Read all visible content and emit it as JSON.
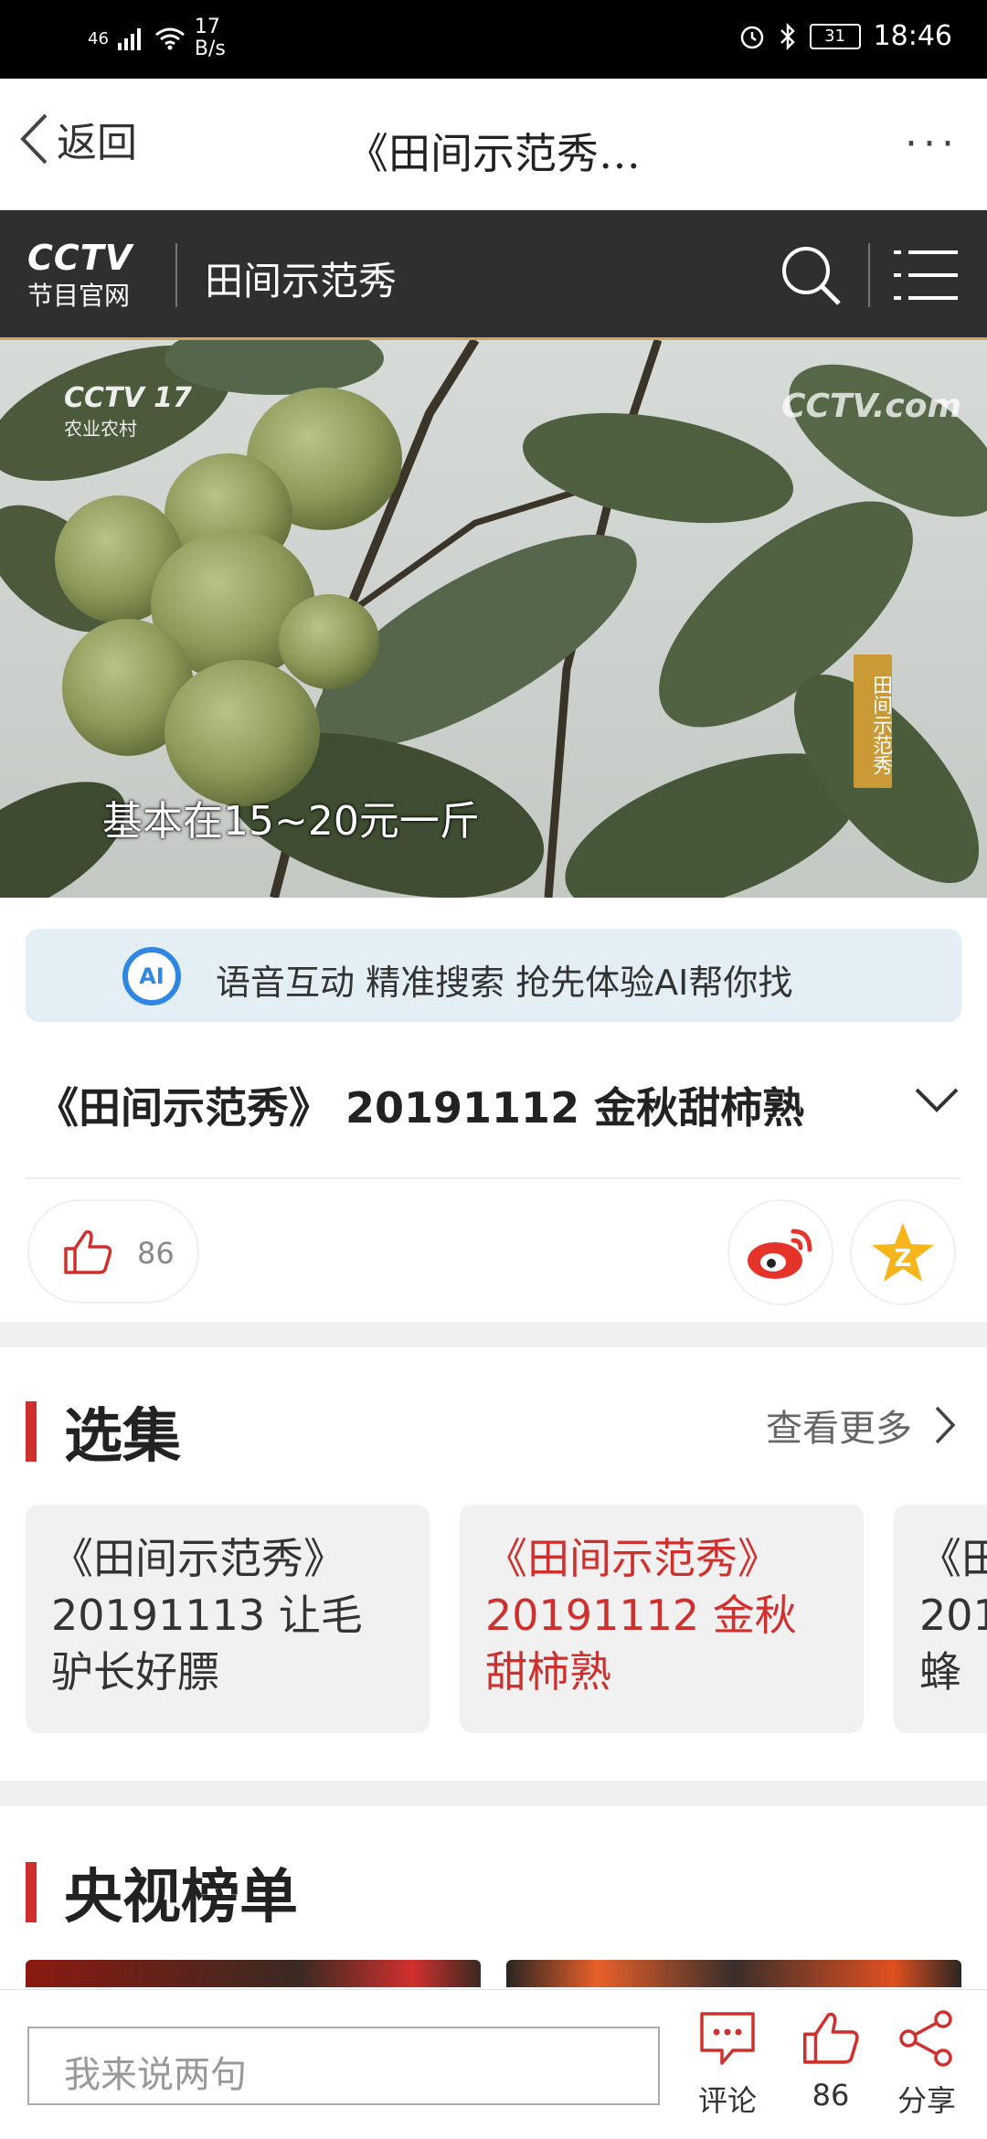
{
  "status_bar": {
    "signal": "46",
    "net_speed_value": "17",
    "net_speed_unit": "B/s",
    "battery": "31",
    "time": "18:46"
  },
  "app_bar": {
    "back_label": "返回",
    "title": "《田间示范秀…",
    "more_label": "···"
  },
  "header": {
    "logo_big": "CCTV",
    "logo_small": "节目官网",
    "title": "田间示范秀"
  },
  "video": {
    "subtitle": "基本在15~20元一斤",
    "watermark_channel": "CCTV 17",
    "watermark_channel_sub": "农业农村",
    "watermark_site": "CCTV.com",
    "side_tag": "田间示范秀"
  },
  "ai_banner": {
    "icon_label": "AI",
    "text": "语音互动 精准搜索 抢先体验AI帮你找"
  },
  "episode": {
    "title": "《田间示范秀》 20191112 金秋甜柿熟",
    "like_count": "86"
  },
  "episodes_section": {
    "title": "选集",
    "see_more": "查看更多",
    "items": [
      {
        "line1": "《田间示范秀》",
        "line2": "20191113 让毛",
        "line3": "驴长好膘",
        "active": false
      },
      {
        "line1": "《田间示范秀》",
        "line2": "20191112 金秋",
        "line3": "甜柿熟",
        "active": true
      },
      {
        "line1": "《田",
        "line2": "201",
        "line3": "蜂",
        "active": false
      }
    ]
  },
  "ranking_section": {
    "title": "央视榜单"
  },
  "bottom_bar": {
    "comment_placeholder": "我来说两句",
    "comment_label": "评论",
    "like_count": "86",
    "share_label": "分享"
  },
  "colors": {
    "accent_red": "#d0302d",
    "header_bg": "#2f2f31",
    "ai_blue": "#2f86e3",
    "weibo_red": "#e6332a",
    "qzone_yellow": "#f5b51b"
  }
}
